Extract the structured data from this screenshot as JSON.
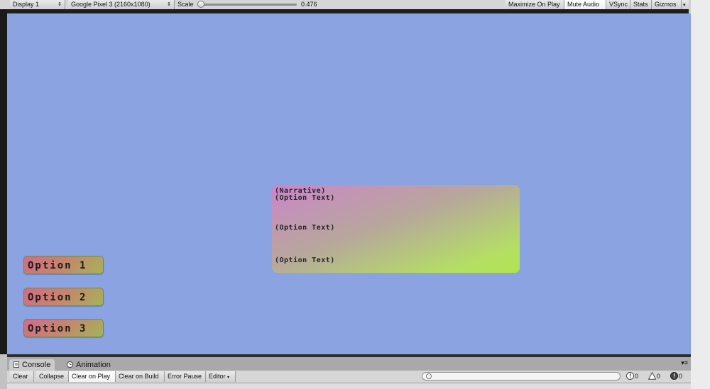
{
  "toolbar": {
    "display": "Display 1",
    "device": "Google Pixel 3 (2160x1080)",
    "scale_label": "Scale",
    "scale_value": "0.476",
    "maximize": "Maximize On Play",
    "mute": "Mute Audio",
    "vsync": "VSync",
    "stats": "Stats",
    "gizmos": "Gizmos"
  },
  "scene": {
    "background": "#8ba3e0",
    "panel": {
      "narrative": "(Narrative)",
      "options": [
        "(Option Text)",
        "(Option Text)",
        "(Option Text)"
      ]
    },
    "buttons": [
      "Option 1",
      "Option 2",
      "Option 3"
    ]
  },
  "tabs": {
    "console": "Console",
    "animation": "Animation"
  },
  "console": {
    "clear": "Clear",
    "collapse": "Collapse",
    "clear_on_play": "Clear on Play",
    "clear_on_build": "Clear on Build",
    "error_pause": "Error Pause",
    "editor": "Editor",
    "logs": "0",
    "warnings": "0",
    "errors": "0"
  }
}
